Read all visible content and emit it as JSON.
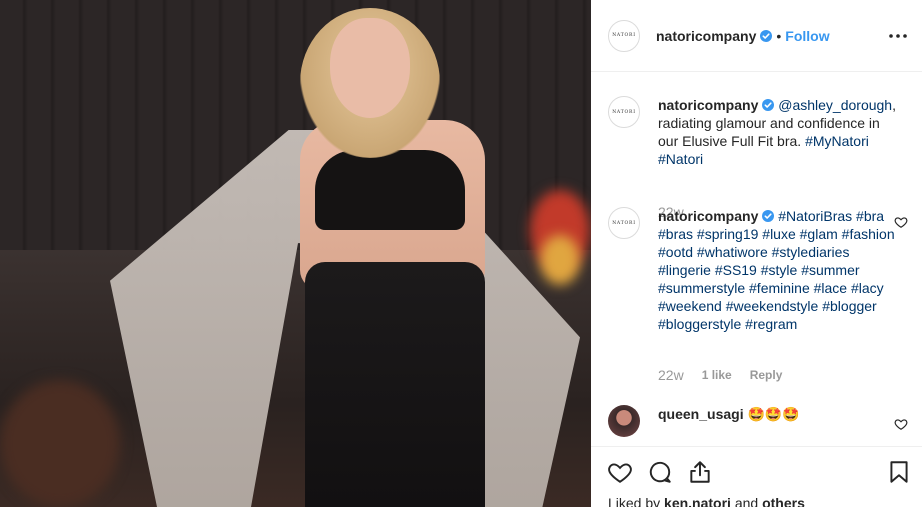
{
  "post": {
    "account": "natoricompany",
    "avatar_text": "NATORI",
    "follow_label": "Follow",
    "separator": "•"
  },
  "caption": {
    "username": "natoricompany",
    "mention": "@ashley_dorough",
    "text": ", radiating glamour and confidence in our Elusive Full Fit bra. ",
    "tag1": "#MyNatori",
    "tag2": "#Natori",
    "time": "22w"
  },
  "comment1": {
    "username": "natoricompany",
    "tags": "#NatoriBras #bra #bras #spring19 #luxe #glam #fashion #ootd #whatiwore #stylediaries #lingerie #SS19 #style #summer #summerstyle #feminine #lace #lacy #weekend #weekendstyle #blogger #bloggerstyle #regram",
    "time": "22w",
    "likes": "1 like",
    "reply": "Reply"
  },
  "comment2": {
    "username": "queen_usagi",
    "text": "🤩🤩🤩"
  },
  "footer": {
    "liked_by_prefix": "Liked by",
    "liked_user": "ken.natori",
    "and": "and",
    "others": "others"
  },
  "colors": {
    "link": "#003569",
    "follow": "#3897f0",
    "verified": "#3897f0",
    "meta": "#999999"
  },
  "icons": [
    "verified-badge-icon",
    "more-options-icon",
    "heart-icon",
    "comment-icon",
    "share-icon",
    "bookmark-icon"
  ]
}
